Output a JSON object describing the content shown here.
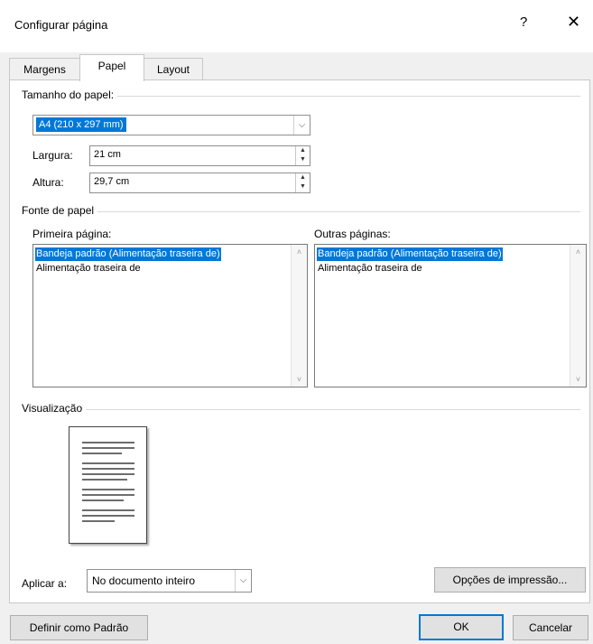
{
  "window": {
    "title": "Configurar página",
    "help_glyph": "?",
    "close_glyph": "✕"
  },
  "tabs": [
    {
      "label": "Margens"
    },
    {
      "label": "Papel"
    },
    {
      "label": "Layout"
    }
  ],
  "paper_size": {
    "group_label": "Tamanho do papel:",
    "selected": "A4 (210 x 297 mm)",
    "width_label": "Largura:",
    "width_value": "21 cm",
    "height_label": "Altura:",
    "height_value": "29,7 cm"
  },
  "paper_source": {
    "group_label": "Fonte de papel",
    "first_page": {
      "label": "Primeira página:",
      "items": [
        "Bandeja padrão (Alimentação traseira de)",
        "Alimentação traseira de"
      ]
    },
    "other_pages": {
      "label": "Outras páginas:",
      "items": [
        "Bandeja padrão (Alimentação traseira de)",
        "Alimentação traseira de"
      ]
    }
  },
  "preview": {
    "group_label": "Visualização"
  },
  "apply_to": {
    "label": "Aplicar a:",
    "selected": "No documento inteiro"
  },
  "buttons": {
    "print_options": "Opções de impressão...",
    "set_default": "Definir como Padrão",
    "ok": "OK",
    "cancel": "Cancelar"
  }
}
